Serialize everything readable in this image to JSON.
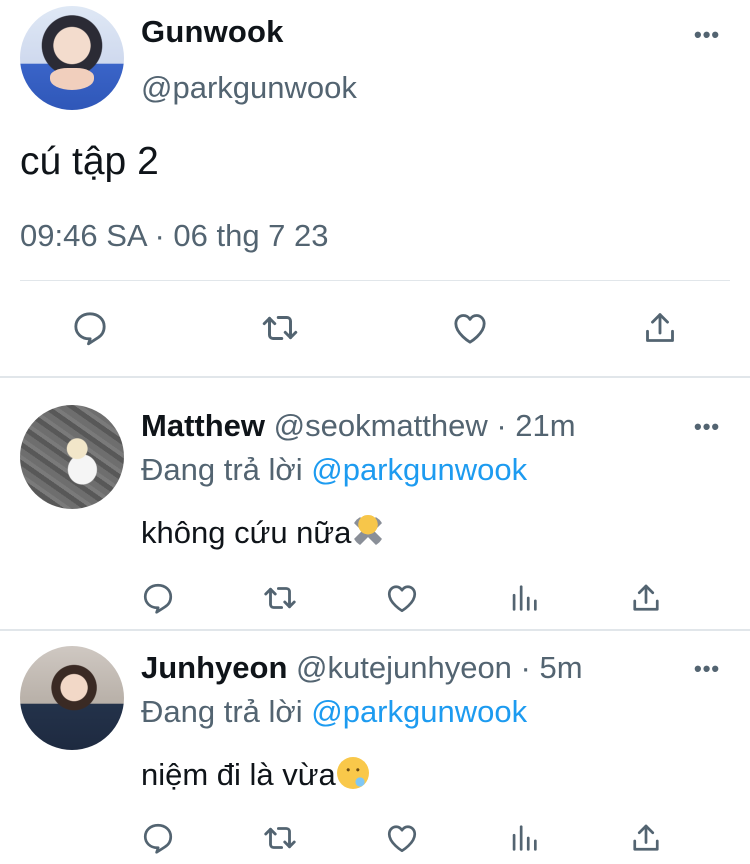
{
  "tweet": {
    "display_name": "Gunwook",
    "handle": "@parkgunwook",
    "text": "cú tập 2",
    "timestamp": "09:46 SA · 06 thg 7 23",
    "more_label": "•••",
    "actions": [
      "reply-icon",
      "retweet-icon",
      "like-icon",
      "share-icon"
    ]
  },
  "replies": [
    {
      "display_name": "Matthew",
      "handle": "@seokmatthew",
      "separator": " · ",
      "time": "21m",
      "replying_prefix": "Đang trả lời ",
      "replying_to": "@parkgunwook",
      "text": "không cứu nữa",
      "emoji": "person-gesturing-no",
      "more_label": "•••",
      "actions": [
        "reply-icon",
        "retweet-icon",
        "like-icon",
        "analytics-icon",
        "share-icon"
      ]
    },
    {
      "display_name": "Junhyeon",
      "handle": "@kutejunhyeon",
      "separator": " · ",
      "time": "5m",
      "replying_prefix": "Đang trả lời ",
      "replying_to": "@parkgunwook",
      "text": "niệm đi là vừa",
      "emoji": "sleepy-face",
      "more_label": "•••",
      "actions": [
        "reply-icon",
        "retweet-icon",
        "like-icon",
        "analytics-icon",
        "share-icon"
      ]
    }
  ],
  "colors": {
    "text": "#0f1419",
    "muted": "#536471",
    "link": "#1d9bf0",
    "divider": "#e1e6ea"
  }
}
